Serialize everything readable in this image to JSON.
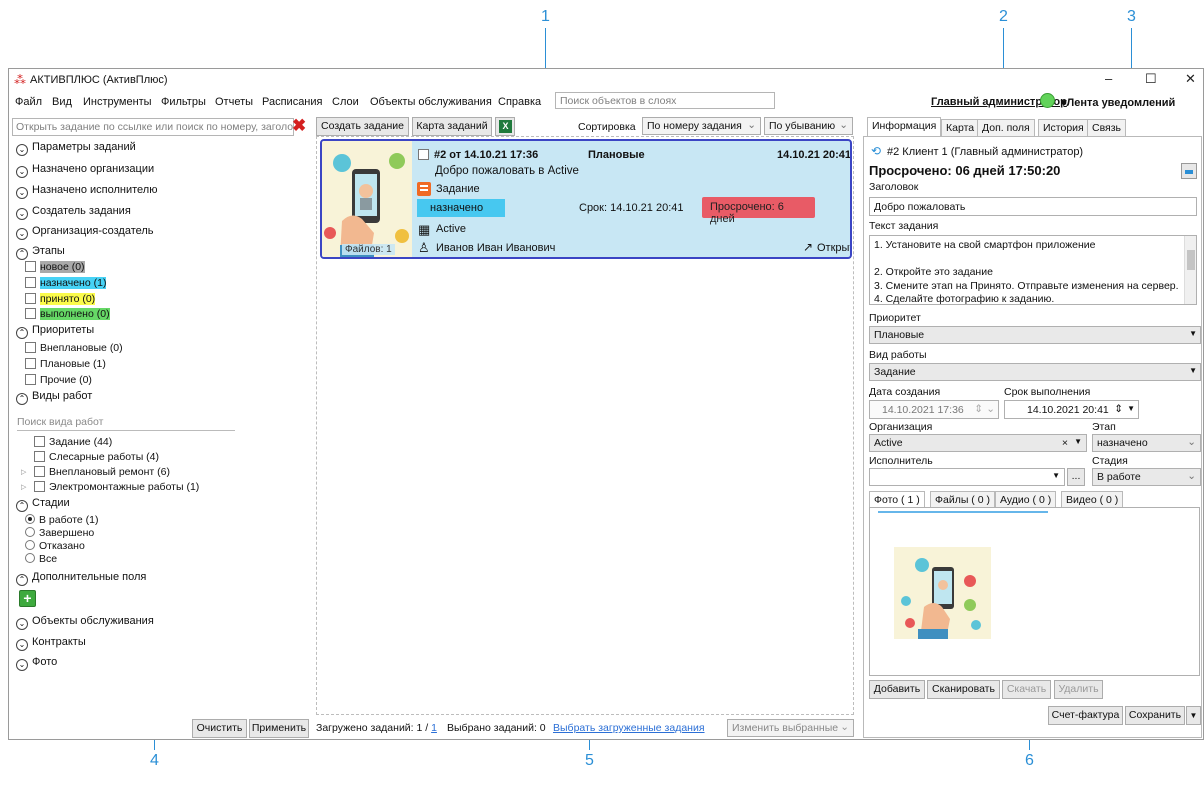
{
  "callouts": [
    "1",
    "2",
    "3",
    "4",
    "5",
    "6"
  ],
  "window": {
    "title": "АКТИВПЛЮС (АктивПлюс)",
    "controls": [
      "–",
      "☐",
      "✕"
    ]
  },
  "menu": [
    "Файл",
    "Вид",
    "Инструменты",
    "Фильтры",
    "Отчеты",
    "Расписания",
    "Слои",
    "Объекты обслуживания",
    "Справка"
  ],
  "layer_search_placeholder": "Поиск объектов в слоях",
  "header": {
    "user": "Главный администратор",
    "notifications": "▾Лента уведомлений"
  },
  "left": {
    "search_placeholder": "Открыть задание по ссылке или поиск по номеру, заголовку",
    "groups": {
      "params": "Параметры заданий",
      "assigned_org": "Назначено организации",
      "assigned_exec": "Назначено исполнителю",
      "creator": "Создатель задания",
      "org_creator": "Организация-создатель",
      "stages": "Этапы",
      "priorities": "Приоритеты",
      "work_types": "Виды работ",
      "states": "Стадии",
      "extra_fields": "Дополнительные поля",
      "service_objects": "Объекты обслуживания",
      "contracts": "Контракты",
      "photo": "Фото"
    },
    "stages": [
      "новое (0)",
      "назначено (1)",
      "принято (0)",
      "выполнено (0)"
    ],
    "priorities": [
      "Внеплановые (0)",
      "Плановые (1)",
      "Прочие (0)"
    ],
    "work_search_placeholder": "Поиск вида работ",
    "work_types": [
      "Задание (44)",
      "Слесарные работы (4)",
      "Внеплановый ремонт (6)",
      "Электромонтажные работы (1)"
    ],
    "states": [
      "В работе (1)",
      "Завершено",
      "Отказано",
      "Все"
    ],
    "clear": "Очистить",
    "apply": "Применить"
  },
  "toolbar": {
    "create": "Создать задание",
    "map": "Карта заданий",
    "sort_label": "Сортировка",
    "sort_by": "По номеру задания",
    "sort_order": "По убыванию"
  },
  "card": {
    "number": "#2  от  14.10.21 17:36",
    "priority": "Плановые",
    "date": "14.10.21 20:41",
    "title": "Добро пожаловать в Active",
    "type": "Задание",
    "stage": "назначено",
    "due": "Срок: 14.10.21 20:41",
    "overdue": "Просрочено: 6 дней",
    "org": "Active",
    "executor": "Иванов Иван Иванович",
    "open": "Открыть",
    "files": "Файлов: 1"
  },
  "footer": {
    "loaded_label": "Загружено заданий: 1 /",
    "loaded_link": "1",
    "selected": "Выбрано заданий: 0",
    "select_loaded": "Выбрать загруженные задания",
    "change_selected": "Изменить выбранные"
  },
  "right": {
    "tabs": [
      "Информация",
      "Карта",
      "Доп. поля",
      "История",
      "Связь"
    ],
    "client": "#2  Клиент 1 (Главный администратор)",
    "overdue": "Просрочено: 06 дней 17:50:20",
    "heading_label": "Заголовок",
    "heading_value": "Добро пожаловать",
    "text_label": "Текст задания",
    "text_lines": [
      "1. Установите на свой смартфон приложение",
      "",
      "2. Откройте это задание",
      "3. Смените этап на Принято. Отправьте изменения на сервер.",
      "4. Сделайте фотографию к заданию."
    ],
    "priority_label": "Приоритет",
    "priority_value": "Плановые",
    "work_label": "Вид работы",
    "work_value": "Задание",
    "created_label": "Дата создания",
    "created_value": "14.10.2021 17:36",
    "deadline_label": "Срок выполнения",
    "deadline_value": "14.10.2021 20:41",
    "org_label": "Организация",
    "org_value": "Active",
    "stage_label": "Этап",
    "stage_value": "назначено",
    "exec_label": "Исполнитель",
    "exec_value": "",
    "state_label": "Стадия",
    "state_value": "В работе",
    "media_tabs": [
      "Фото  ( 1 )",
      "Файлы  ( 0 )",
      "Аудио  ( 0 )",
      "Видео  ( 0 )"
    ],
    "add": "Добавить",
    "scan": "Сканировать",
    "download": "Скачать",
    "delete": "Удалить",
    "invoice": "Счет-фактура",
    "save": "Сохранить"
  },
  "colors": {
    "accent": "#2b8fd6",
    "card_bg": "#c8e7f4",
    "card_border": "#3b45c4",
    "stage_badge": "#47c8f0",
    "overdue_badge": "#e85b66",
    "status_online": "#62d35a"
  }
}
